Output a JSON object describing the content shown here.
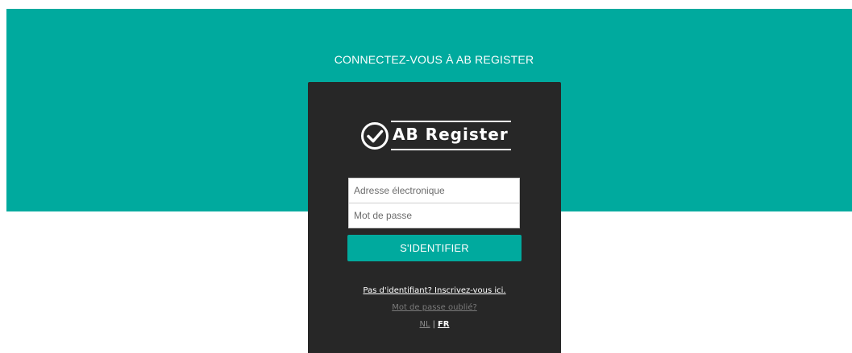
{
  "header": {
    "title": "CONNECTEZ-VOUS À AB REGISTER"
  },
  "logo": {
    "text": "AB Register",
    "icon": "check-circle-icon"
  },
  "login_form": {
    "email_placeholder": "Adresse électronique",
    "email_value": "",
    "password_placeholder": "Mot de passe",
    "password_value": "",
    "submit_label": "S'IDENTIFIER"
  },
  "links": {
    "register": "Pas d'identifiant? Inscrivez-vous ici.",
    "forgot_password": "Mot de passe oublié?"
  },
  "languages": {
    "options": [
      "NL",
      "FR"
    ],
    "separator": "|",
    "selected": "FR"
  },
  "colors": {
    "accent": "#00aa9e",
    "panel": "#272727",
    "background": "#ffffff"
  }
}
